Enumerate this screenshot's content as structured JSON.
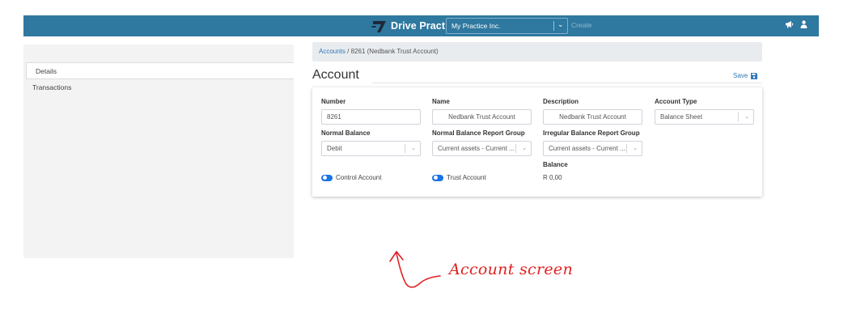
{
  "header": {
    "brand_name": "Drive Practice",
    "company_select_value": "My Practice Inc.",
    "create_placeholder": "Create",
    "icons": [
      "megaphone-icon",
      "user-icon"
    ]
  },
  "sidebar": {
    "items": [
      {
        "label": "Details",
        "active": true
      },
      {
        "label": "Transactions",
        "active": false
      }
    ]
  },
  "breadcrumb": {
    "link": "Accounts",
    "separator": "/",
    "current": "8261 (Nedbank Trust Account)"
  },
  "page": {
    "title": "Account",
    "save_label": "Save"
  },
  "form": {
    "number": {
      "label": "Number",
      "value": "8261"
    },
    "name": {
      "label": "Name",
      "value": "Nedbank Trust Account"
    },
    "description": {
      "label": "Description",
      "value": "Nedbank Trust Account"
    },
    "account_type": {
      "label": "Account Type",
      "value": "Balance Sheet"
    },
    "normal_balance": {
      "label": "Normal Balance",
      "value": "Debit"
    },
    "normal_balance_report_group": {
      "label": "Normal Balance Report Group",
      "value": "Current assets - Current ..."
    },
    "irregular_balance_report_group": {
      "label": "Irregular Balance Report Group",
      "value": "Current assets - Current ..."
    },
    "balance": {
      "label": "Balance",
      "value": "R 0,00"
    },
    "control_account": {
      "label": "Control Account",
      "checked": true
    },
    "trust_account": {
      "label": "Trust Account",
      "checked": true
    }
  },
  "annotation": {
    "text": "Account screen"
  },
  "colors": {
    "topbar": "#2f789f",
    "link": "#2f78b7",
    "toggle": "#1a73e8",
    "annotation": "#e02020"
  }
}
